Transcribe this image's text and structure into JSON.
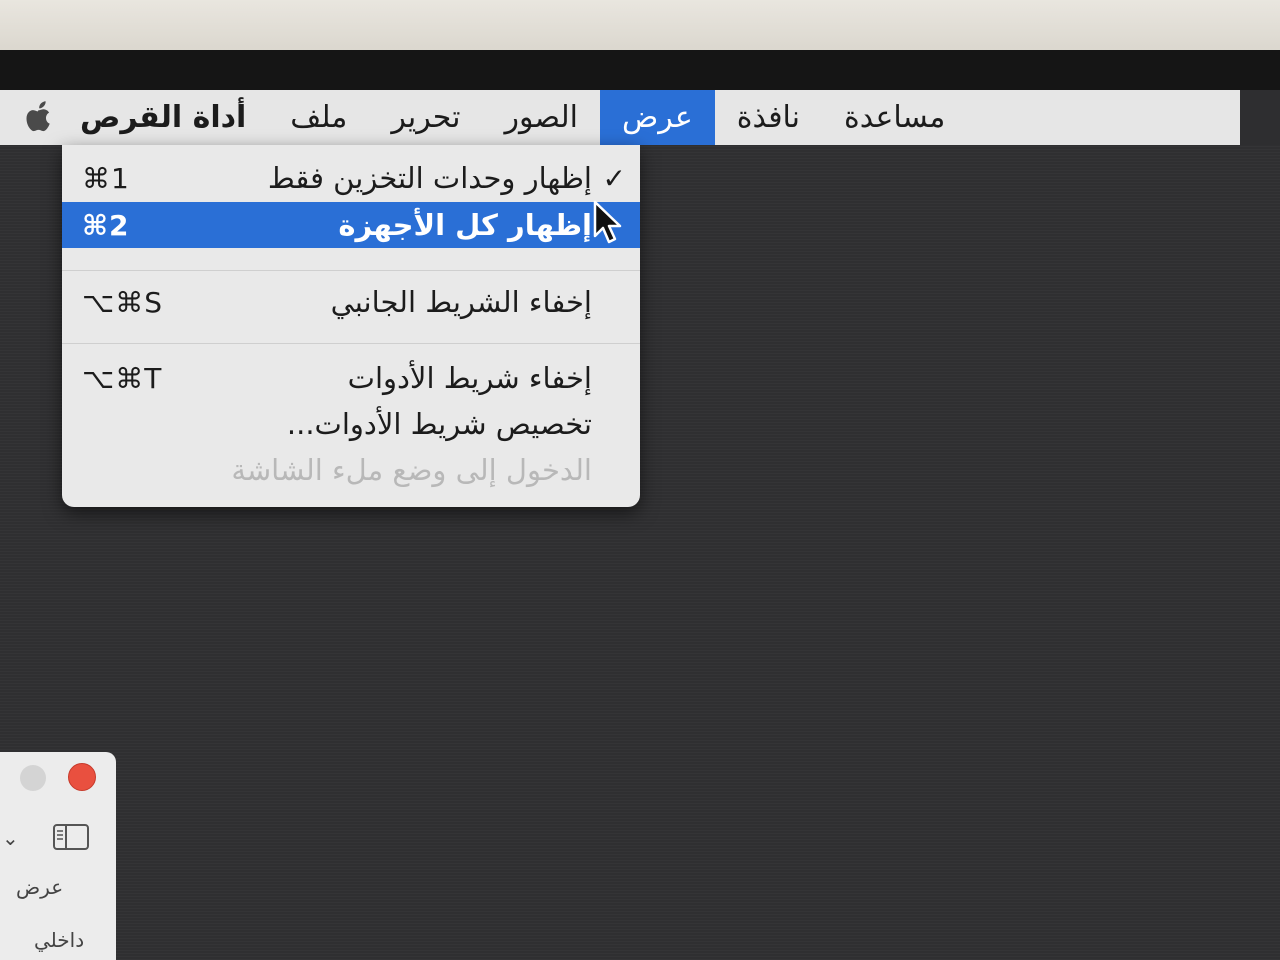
{
  "menubar": {
    "apple": "apple-icon",
    "items": [
      {
        "label": "أداة القرص"
      },
      {
        "label": "ملف"
      },
      {
        "label": "تحرير"
      },
      {
        "label": "الصور"
      },
      {
        "label": "عرض",
        "active": true
      },
      {
        "label": "نافذة"
      },
      {
        "label": "مساعدة"
      }
    ]
  },
  "view_menu": {
    "show_volumes_only": {
      "label": "إظهار وحدات التخزين فقط",
      "shortcut": "⌘1",
      "checked": "✓"
    },
    "show_all_devices": {
      "label": "إظهار كل الأجهزة",
      "shortcut": "⌘2"
    },
    "hide_sidebar": {
      "label": "إخفاء الشريط الجانبي",
      "shortcut": "⌥⌘S"
    },
    "hide_toolbar": {
      "label": "إخفاء شريط الأدوات",
      "shortcut": "⌥⌘T"
    },
    "customize_toolbar": {
      "label": "تخصيص شريط الأدوات..."
    },
    "enter_fullscreen": {
      "label": "الدخول إلى وضع ملء الشاشة"
    }
  },
  "finder_window": {
    "view_label": "عرض",
    "internal_label": "داخلي"
  },
  "colors": {
    "accent": "#2a6fd6",
    "menubar": "#e6e6e6",
    "desktop": "#2f2f31",
    "close": "#e9503f"
  }
}
